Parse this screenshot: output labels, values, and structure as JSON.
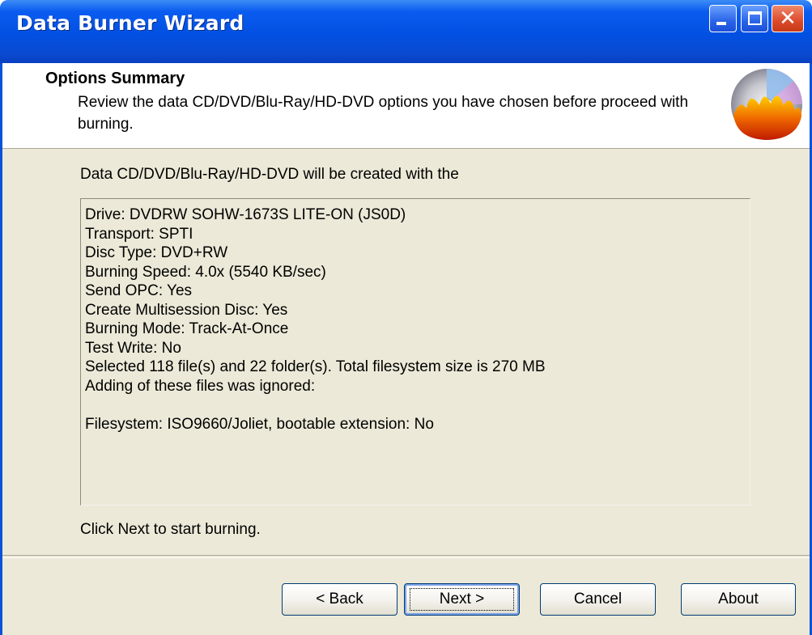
{
  "window": {
    "title": "Data Burner Wizard"
  },
  "header": {
    "title": "Options Summary",
    "description": "Review the data CD/DVD/Blu-Ray/HD-DVD options you have chosen before proceed with burning."
  },
  "intro": "Data CD/DVD/Blu-Ray/HD-DVD will be created with the",
  "summary": {
    "lines": [
      "Drive: DVDRW SOHW-1673S LITE-ON  (JS0D)",
      "Transport: SPTI",
      "Disc Type: DVD+RW",
      "Burning Speed: 4.0x (5540 KB/sec)",
      "Send OPC: Yes",
      "Create Multisession Disc: Yes",
      "Burning Mode: Track-At-Once",
      "Test Write: No",
      "Selected 118 file(s) and 22 folder(s). Total filesystem size is 270 MB",
      "Adding of these files was ignored:",
      "",
      "Filesystem: ISO9660/Joliet, bootable extension: No"
    ]
  },
  "footer_hint": "Click Next to start burning.",
  "buttons": {
    "back": "< Back",
    "next": "Next >",
    "cancel": "Cancel",
    "about": "About"
  },
  "icons": {
    "minimize": "minimize-icon",
    "maximize": "maximize-icon",
    "close": "close-icon",
    "logo": "disc-flame-logo"
  }
}
